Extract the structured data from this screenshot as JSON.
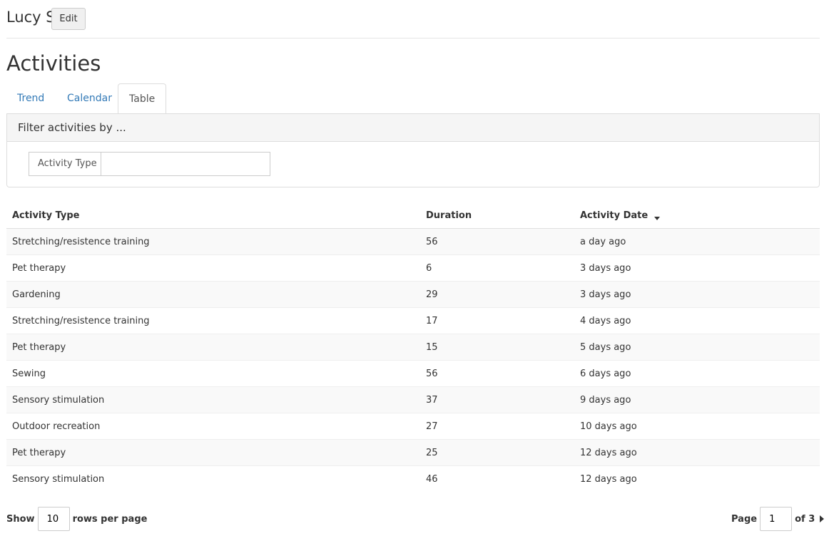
{
  "header": {
    "resident_name": "Lucy S",
    "edit_label": "Edit"
  },
  "page_title": "Activities",
  "tabs": [
    {
      "label": "Trend",
      "active": false
    },
    {
      "label": "Calendar",
      "active": false
    },
    {
      "label": "Table",
      "active": true
    }
  ],
  "filter": {
    "heading": "Filter activities by ...",
    "activity_type_label": "Activity Type",
    "activity_type_value": ""
  },
  "table": {
    "columns": [
      "Activity Type",
      "Duration",
      "Activity Date"
    ],
    "sort": {
      "column": "Activity Date",
      "direction": "descending",
      "icon": "caret-down-icon"
    },
    "rows": [
      [
        "Stretching/resistence training",
        "56",
        "a day ago"
      ],
      [
        "Pet therapy",
        "6",
        "3 days ago"
      ],
      [
        "Gardening",
        "29",
        "3 days ago"
      ],
      [
        "Stretching/resistence training",
        "17",
        "4 days ago"
      ],
      [
        "Pet therapy",
        "15",
        "5 days ago"
      ],
      [
        "Sewing",
        "56",
        "6 days ago"
      ],
      [
        "Sensory stimulation",
        "37",
        "9 days ago"
      ],
      [
        "Outdoor recreation",
        "27",
        "10 days ago"
      ],
      [
        "Pet therapy",
        "25",
        "12 days ago"
      ],
      [
        "Sensory stimulation",
        "46",
        "12 days ago"
      ]
    ]
  },
  "pagination": {
    "show_label": "Show",
    "rows_per_page": "10",
    "rows_per_page_label": "rows per page",
    "page_label": "Page",
    "current_page": "1",
    "total_label": "of 3",
    "next_icon": "caret-right-icon"
  }
}
